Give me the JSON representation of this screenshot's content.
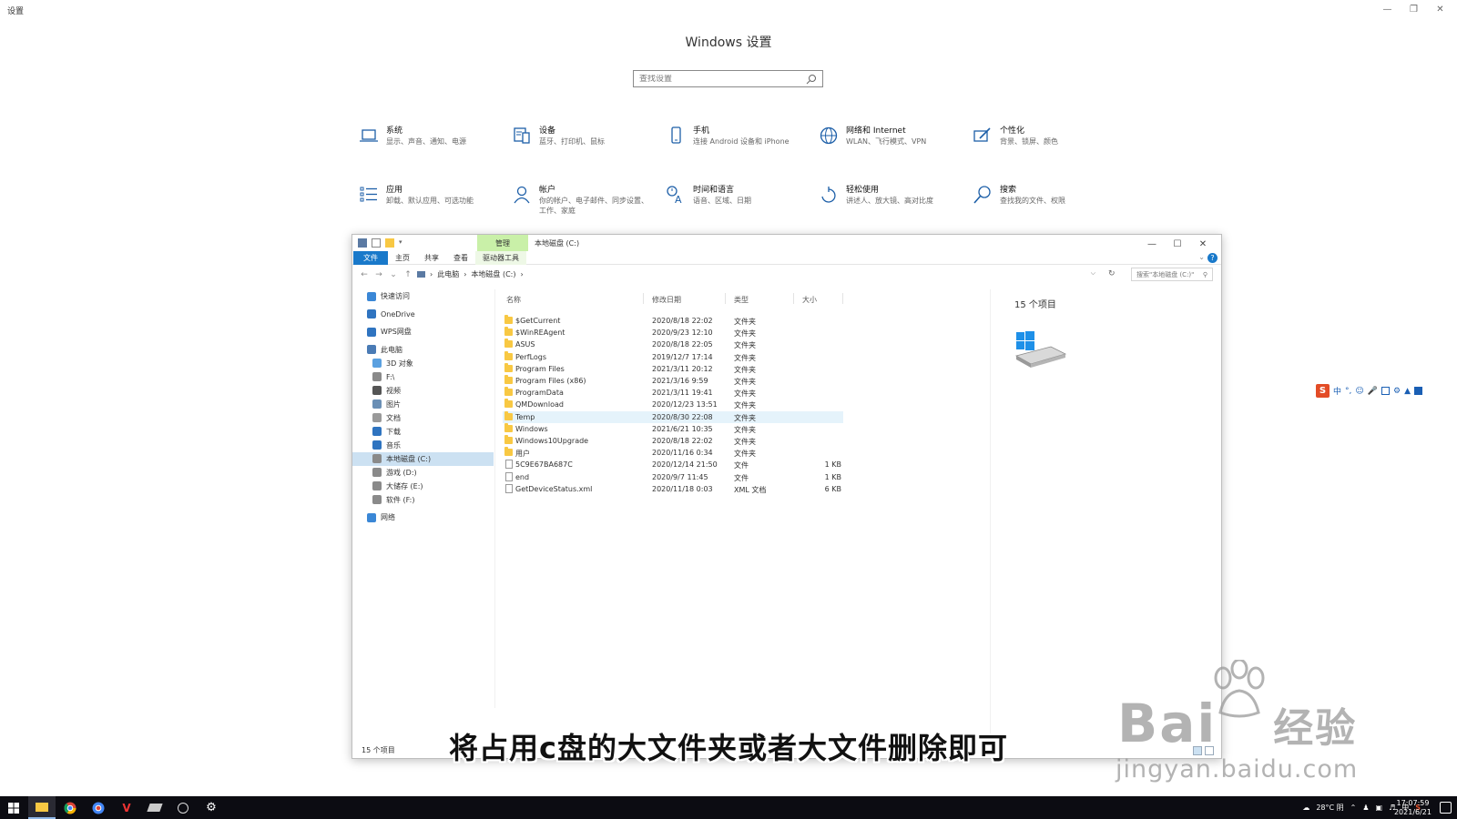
{
  "window": {
    "app_title": "设置",
    "page_title": "Windows 设置",
    "search_placeholder": "查找设置"
  },
  "categories": [
    {
      "icon": "laptop-icon",
      "label": "系统",
      "desc": "显示、声音、通知、电源"
    },
    {
      "icon": "keyboard-icon",
      "label": "设备",
      "desc": "蓝牙、打印机、鼠标"
    },
    {
      "icon": "phone-icon",
      "label": "手机",
      "desc": "连接 Android 设备和 iPhone"
    },
    {
      "icon": "globe-icon",
      "label": "网络和 Internet",
      "desc": "WLAN、飞行模式、VPN"
    },
    {
      "icon": "paintbrush-icon",
      "label": "个性化",
      "desc": "背景、锁屏、颜色"
    },
    {
      "icon": "apps-list-icon",
      "label": "应用",
      "desc": "卸载、默认应用、可选功能"
    },
    {
      "icon": "person-icon",
      "label": "帐户",
      "desc": "你的帐户、电子邮件、同步设置、工作、家庭"
    },
    {
      "icon": "time-language-icon",
      "label": "时间和语言",
      "desc": "语音、区域、日期"
    },
    {
      "icon": "ease-of-access-icon",
      "label": "轻松使用",
      "desc": "讲述人、放大镜、高对比度"
    },
    {
      "icon": "search-icon",
      "label": "搜索",
      "desc": "查找我的文件、权限"
    }
  ],
  "explorer": {
    "manage_tab": "管理",
    "title": "本地磁盘 (C:)",
    "ribbon_tabs": [
      "文件",
      "主页",
      "共享",
      "查看",
      "驱动器工具"
    ],
    "breadcrumb": [
      "此电脑",
      "本地磁盘 (C:)"
    ],
    "search_placeholder": "搜索\"本地磁盘 (C:)\"",
    "nav_tree": [
      {
        "label": "快速访问",
        "icon": "star-icon",
        "level": 0
      },
      {
        "label": "OneDrive",
        "icon": "cloud-icon",
        "level": 0
      },
      {
        "label": "WPS网盘",
        "icon": "cloud-icon",
        "level": 0
      },
      {
        "label": "此电脑",
        "icon": "computer-icon",
        "level": 0
      },
      {
        "label": "3D 对象",
        "icon": "cube-icon",
        "level": 1
      },
      {
        "label": "F:\\",
        "icon": "drive-icon",
        "level": 1
      },
      {
        "label": "视频",
        "icon": "video-icon",
        "level": 1
      },
      {
        "label": "图片",
        "icon": "picture-icon",
        "level": 1
      },
      {
        "label": "文档",
        "icon": "document-icon",
        "level": 1
      },
      {
        "label": "下载",
        "icon": "download-icon",
        "level": 1
      },
      {
        "label": "音乐",
        "icon": "music-icon",
        "level": 1
      },
      {
        "label": "本地磁盘 (C:)",
        "icon": "drive-icon",
        "level": 1,
        "selected": true
      },
      {
        "label": "游戏 (D:)",
        "icon": "drive-icon",
        "level": 1
      },
      {
        "label": "大储存 (E:)",
        "icon": "drive-icon",
        "level": 1
      },
      {
        "label": "软件 (F:)",
        "icon": "drive-icon",
        "level": 1
      },
      {
        "label": "网络",
        "icon": "network-icon",
        "level": 0
      }
    ],
    "columns": [
      "名称",
      "修改日期",
      "类型",
      "大小"
    ],
    "files": [
      {
        "name": "$GetCurrent",
        "date": "2020/8/18 22:02",
        "type": "文件夹",
        "size": "",
        "kind": "folder"
      },
      {
        "name": "$WinREAgent",
        "date": "2020/9/23 12:10",
        "type": "文件夹",
        "size": "",
        "kind": "folder"
      },
      {
        "name": "ASUS",
        "date": "2020/8/18 22:05",
        "type": "文件夹",
        "size": "",
        "kind": "folder"
      },
      {
        "name": "PerfLogs",
        "date": "2019/12/7 17:14",
        "type": "文件夹",
        "size": "",
        "kind": "folder"
      },
      {
        "name": "Program Files",
        "date": "2021/3/11 20:12",
        "type": "文件夹",
        "size": "",
        "kind": "folder"
      },
      {
        "name": "Program Files (x86)",
        "date": "2021/3/16 9:59",
        "type": "文件夹",
        "size": "",
        "kind": "folder"
      },
      {
        "name": "ProgramData",
        "date": "2021/3/11 19:41",
        "type": "文件夹",
        "size": "",
        "kind": "folder"
      },
      {
        "name": "QMDownload",
        "date": "2020/12/23 13:51",
        "type": "文件夹",
        "size": "",
        "kind": "folder"
      },
      {
        "name": "Temp",
        "date": "2020/8/30 22:08",
        "type": "文件夹",
        "size": "",
        "kind": "folder",
        "hover": true
      },
      {
        "name": "Windows",
        "date": "2021/6/21 10:35",
        "type": "文件夹",
        "size": "",
        "kind": "folder"
      },
      {
        "name": "Windows10Upgrade",
        "date": "2020/8/18 22:02",
        "type": "文件夹",
        "size": "",
        "kind": "folder"
      },
      {
        "name": "用户",
        "date": "2020/11/16 0:34",
        "type": "文件夹",
        "size": "",
        "kind": "folder"
      },
      {
        "name": "5C9E67BA687C",
        "date": "2020/12/14 21:50",
        "type": "文件",
        "size": "1 KB",
        "kind": "file"
      },
      {
        "name": "end",
        "date": "2020/9/7 11:45",
        "type": "文件",
        "size": "1 KB",
        "kind": "file"
      },
      {
        "name": "GetDeviceStatus.xml",
        "date": "2020/11/18 0:03",
        "type": "XML 文档",
        "size": "6 KB",
        "kind": "file"
      }
    ],
    "item_count": "15 个项目",
    "status_text": "15 个项目"
  },
  "subtitle": "将占用c盘的大文件夹或者大文件删除即可",
  "watermark": {
    "brand": "Bai",
    "cn": "经验",
    "url": "jingyan.baidu.com"
  },
  "taskbar": {
    "weather": "28°C 阴",
    "time": "17:07:59",
    "date": "2021/6/21",
    "ime_lang": "中"
  },
  "colors": {
    "accent": "#1979ca",
    "manage_tab": "#c9f0a8",
    "folder": "#f8c843",
    "taskbar": "#0c0c12"
  }
}
